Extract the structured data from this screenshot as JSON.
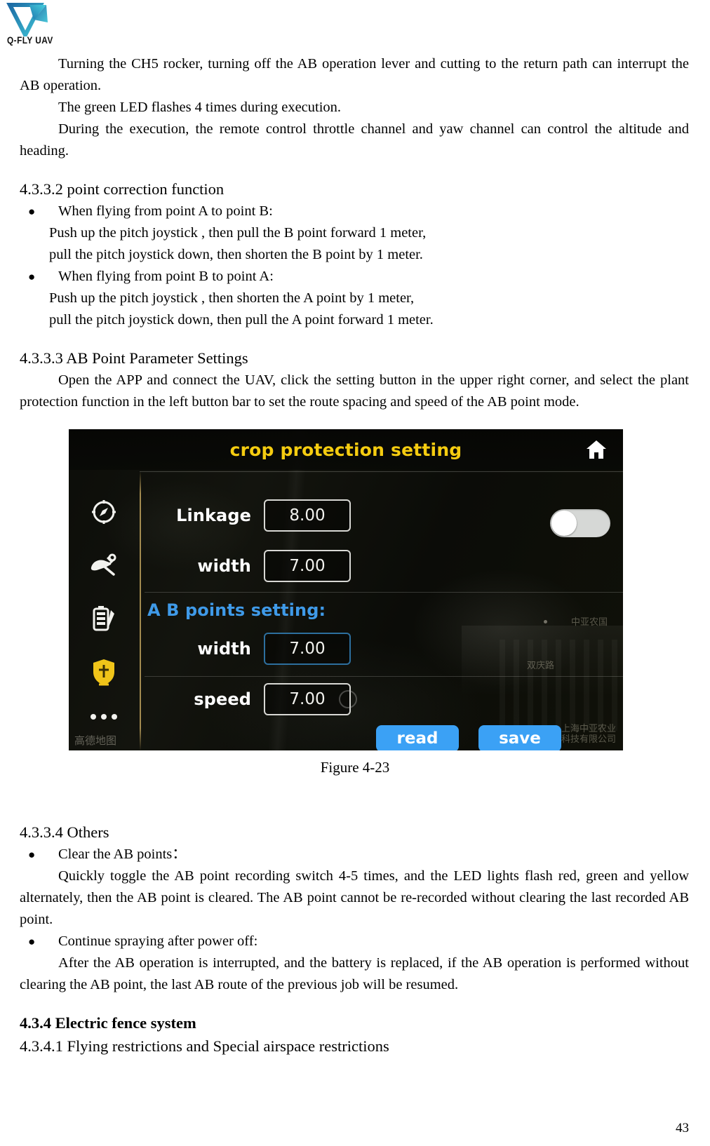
{
  "brand": {
    "logo_name": "q-fly-uav-logo",
    "logo_text": "Q-FLY UAV",
    "logo_color_dark": "#1f6ea8",
    "logo_color_light": "#3fc6d8"
  },
  "document": {
    "page_number": "43",
    "paragraphs": {
      "p1": "Turning the CH5 rocker, turning off the AB operation lever and cutting to the return path can interrupt the AB operation.",
      "p2": "The green LED flashes 4 times during execution.",
      "p3": "During the execution, the remote control throttle channel and yaw channel can control the altitude and heading."
    },
    "section_4332": {
      "heading": "4.3.3.2 point correction function",
      "bullet1": "When flying from point A to point B:",
      "b1_line1": "Push up the pitch joystick , then pull the B point forward 1 meter,",
      "b1_line2": "pull the pitch joystick down, then shorten the B point by 1 meter.",
      "bullet2": "When flying from point B to point A:",
      "b2_line1": "Push up the pitch joystick , then shorten the A point by 1 meter,",
      "b2_line2": "pull the pitch joystick down, then pull the A point forward 1 meter."
    },
    "section_4333": {
      "heading": "4.3.3.3    AB Point Parameter Settings",
      "body": "Open the APP and connect the UAV, click the setting button in the upper right corner, and select the plant protection function in the left button bar to set the route spacing and speed of the AB point mode.",
      "figure_caption": "Figure 4-23"
    },
    "section_4334": {
      "heading": "4.3.3.4 Others",
      "bullet1": "Clear the AB points：",
      "b1_body": "Quickly toggle the AB point recording switch 4-5 times, and the LED lights flash red, green and yellow alternately, then the AB point is cleared. The AB point cannot be re-recorded without clearing the last recorded AB point.",
      "bullet2": "Continue spraying after power off:",
      "b2_body": "After the AB operation is interrupted, and the battery is replaced, if the AB operation is performed without clearing the AB point, the last AB route of the previous job will be resumed."
    },
    "section_434": {
      "heading": "4.3.4    Electric fence system",
      "sub_heading": "4.3.4.1 Flying restrictions and Special airspace restrictions"
    }
  },
  "app": {
    "header": {
      "title": "crop protection setting",
      "title_color": "#f5cc10",
      "home_icon": "home-icon"
    },
    "sidebar": {
      "items": [
        {
          "icon": "compass-icon",
          "active": false
        },
        {
          "icon": "aircraft-wrench-icon",
          "active": false
        },
        {
          "icon": "battery-checklist-icon",
          "active": false
        },
        {
          "icon": "shield-crop-protection-icon",
          "active": true
        },
        {
          "icon": "more-dots-icon",
          "active": false
        }
      ],
      "active_color": "#f0c419",
      "inactive_color": "#f2f2ee"
    },
    "settings": {
      "linkage": {
        "label": "Linkage",
        "value": "8.00"
      },
      "width_top": {
        "label": "width",
        "value": "7.00"
      },
      "ab_section_label": "A B points setting:",
      "ab_section_color": "#3f9ae8",
      "ab_width": {
        "label": "width",
        "value": "7.00"
      },
      "ab_speed": {
        "label": "speed",
        "value": "7.00"
      },
      "toggle": {
        "name": "linkage-toggle",
        "state": "off"
      }
    },
    "buttons": {
      "read": "read",
      "save": "save",
      "color": "#3ba1f5"
    },
    "watermarks": {
      "amap": "高德地图",
      "label1": "中亚农国",
      "label2": "双庆路",
      "label3_line1": "上海中亚农业",
      "label3_line2": "科技有限公司"
    }
  }
}
